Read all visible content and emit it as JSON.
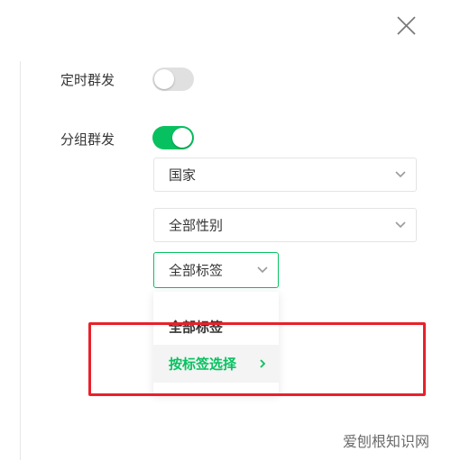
{
  "settings": {
    "scheduled_send": {
      "label": "定时群发",
      "enabled": false
    },
    "group_send": {
      "label": "分组群发",
      "enabled": true
    }
  },
  "filters": {
    "country": {
      "value": "国家"
    },
    "gender": {
      "value": "全部性别"
    },
    "tag": {
      "value": "全部标签"
    }
  },
  "dropdown": {
    "items": [
      {
        "label": "全部标签"
      },
      {
        "label": "按标签选择"
      }
    ]
  },
  "watermark": "爱刨根知识网",
  "colors": {
    "accent": "#07c160",
    "highlight": "#e8212b",
    "toggle_off": "#e0e0e0"
  },
  "icons": {
    "close": "close-icon",
    "chevron": "chevron-down-icon",
    "arrow": "chevron-right-icon"
  }
}
